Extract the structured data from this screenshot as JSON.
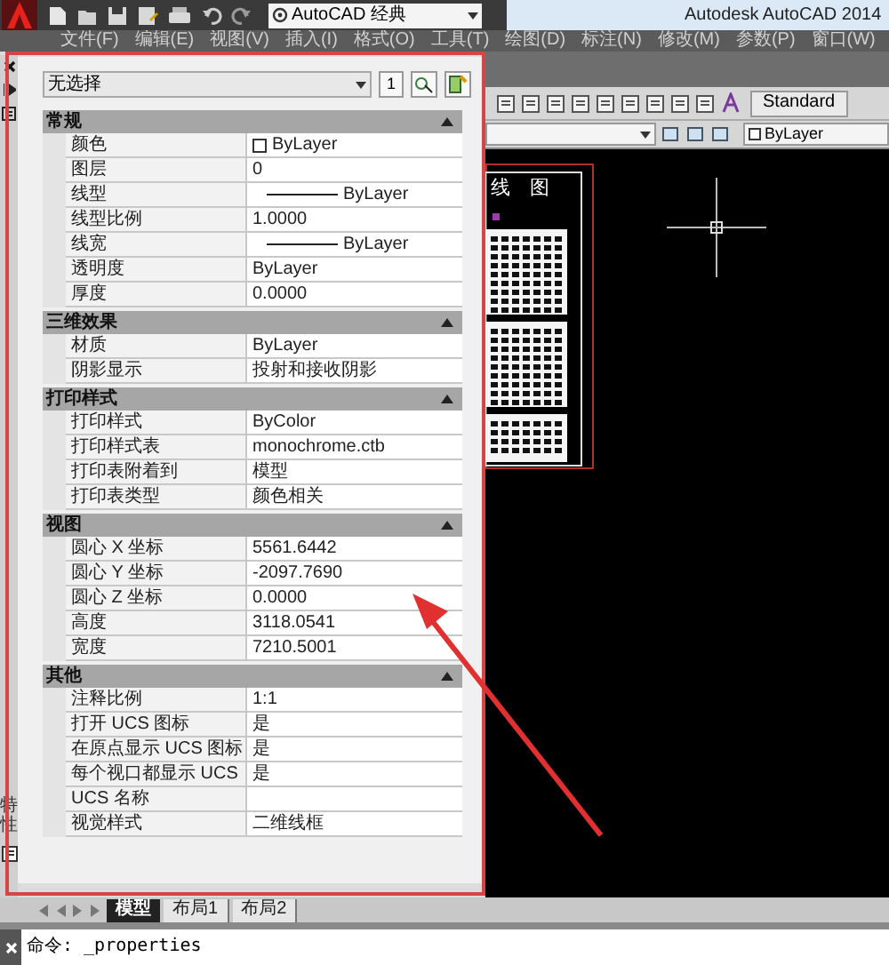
{
  "title_bar": {
    "workspace": "AutoCAD 经典",
    "title": "Autodesk AutoCAD 2014"
  },
  "menu": [
    "文件(F)",
    "编辑(E)",
    "视图(V)",
    "插入(I)",
    "格式(O)",
    "工具(T)",
    "绘图(D)",
    "标注(N)",
    "修改(M)",
    "参数(P)",
    "窗口(W)"
  ],
  "toolbar": {
    "text_style": "Standard",
    "layer_combo": "ByLayer"
  },
  "palette": {
    "side_title": "特性",
    "selection": "无选择",
    "toggle_button": "1",
    "sections": [
      {
        "title": "常规",
        "expanded": true,
        "rows": [
          {
            "label": "颜色",
            "value": "ByLayer",
            "kind": "color"
          },
          {
            "label": "图层",
            "value": "0",
            "kind": "text"
          },
          {
            "label": "线型",
            "value": "ByLayer",
            "kind": "line"
          },
          {
            "label": "线型比例",
            "value": "1.0000",
            "kind": "text"
          },
          {
            "label": "线宽",
            "value": "ByLayer",
            "kind": "line"
          },
          {
            "label": "透明度",
            "value": "ByLayer",
            "kind": "text"
          },
          {
            "label": "厚度",
            "value": "0.0000",
            "kind": "text"
          }
        ]
      },
      {
        "title": "三维效果",
        "expanded": true,
        "rows": [
          {
            "label": "材质",
            "value": "ByLayer",
            "kind": "text"
          },
          {
            "label": "阴影显示",
            "value": "投射和接收阴影",
            "kind": "text"
          }
        ]
      },
      {
        "title": "打印样式",
        "expanded": true,
        "rows": [
          {
            "label": "打印样式",
            "value": "ByColor",
            "kind": "text"
          },
          {
            "label": "打印样式表",
            "value": "monochrome.ctb",
            "kind": "text"
          },
          {
            "label": "打印表附着到",
            "value": "模型",
            "kind": "text"
          },
          {
            "label": "打印表类型",
            "value": "颜色相关",
            "kind": "text"
          }
        ]
      },
      {
        "title": "视图",
        "expanded": true,
        "rows": [
          {
            "label": "圆心 X 坐标",
            "value": "5561.6442",
            "kind": "text"
          },
          {
            "label": "圆心 Y 坐标",
            "value": "-2097.7690",
            "kind": "text"
          },
          {
            "label": "圆心 Z 坐标",
            "value": "0.0000",
            "kind": "text"
          },
          {
            "label": "高度",
            "value": "3118.0541",
            "kind": "text"
          },
          {
            "label": "宽度",
            "value": "7210.5001",
            "kind": "text"
          }
        ]
      },
      {
        "title": "其他",
        "expanded": true,
        "rows": [
          {
            "label": "注释比例",
            "value": "1:1",
            "kind": "text"
          },
          {
            "label": "打开 UCS 图标",
            "value": "是",
            "kind": "text"
          },
          {
            "label": "在原点显示 UCS 图标",
            "value": "是",
            "kind": "text"
          },
          {
            "label": "每个视口都显示 UCS",
            "value": "是",
            "kind": "text"
          },
          {
            "label": "UCS 名称",
            "kind": "text"
          },
          {
            "label": "视觉样式",
            "value": "二维线框",
            "kind": "text"
          }
        ]
      }
    ]
  },
  "canvas": {
    "drawing_title": "线 图"
  },
  "layout_tabs": [
    {
      "label": "模型",
      "selected": true
    },
    {
      "label": "布局1",
      "selected": false
    },
    {
      "label": "布局2",
      "selected": false
    }
  ],
  "command_line": "命令: _properties"
}
